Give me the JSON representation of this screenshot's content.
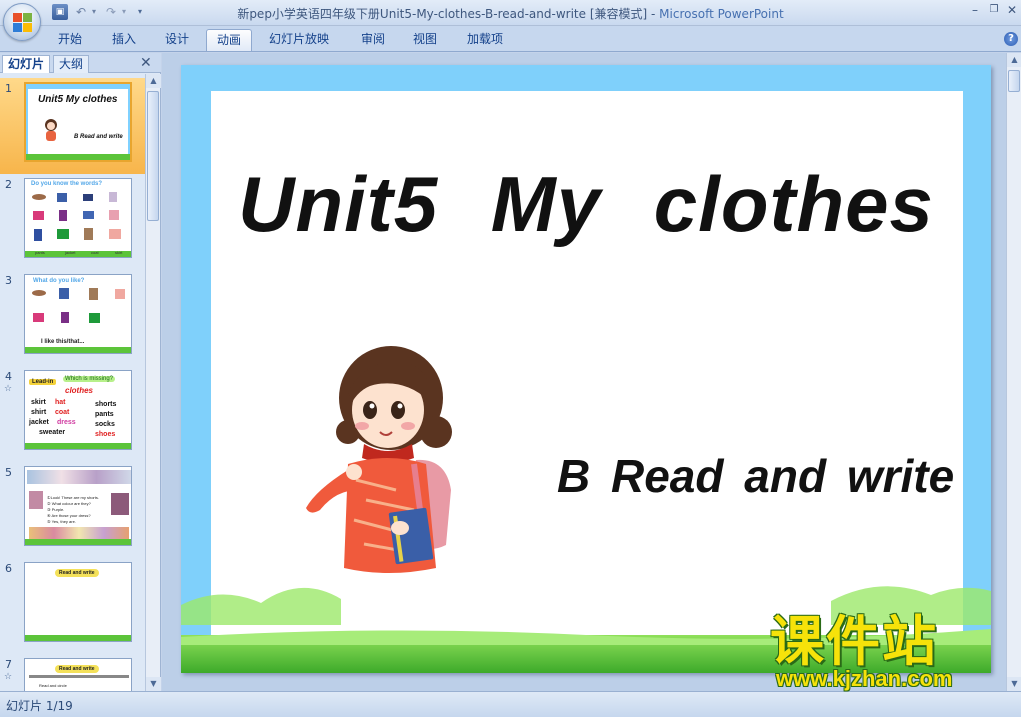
{
  "window": {
    "title": "新pep小学英语四年级下册Unit5-My-clothes-B-read-and-write [兼容模式]",
    "separator": " - ",
    "app_name": "Microsoft PowerPoint",
    "minimize": "–",
    "restore": "❐",
    "close": "✕"
  },
  "quick_access": {
    "save": "▣",
    "undo": "↶",
    "redo": "↷",
    "dropdown": "▾",
    "customize": "▾"
  },
  "ribbon_tabs": [
    {
      "label": "开始"
    },
    {
      "label": "插入"
    },
    {
      "label": "设计"
    },
    {
      "label": "动画",
      "active": true
    },
    {
      "label": "幻灯片放映"
    },
    {
      "label": "审阅"
    },
    {
      "label": "视图"
    },
    {
      "label": "加载项"
    }
  ],
  "help": "?",
  "panel": {
    "tab_slides": "幻灯片",
    "tab_outline": "大纲",
    "close": "✕",
    "scroll_up": "▲",
    "scroll_down": "▼"
  },
  "thumbnails": [
    {
      "num": "1",
      "selected": true,
      "title": "Unit5 My clothes",
      "sub": "B  Read and write"
    },
    {
      "num": "2",
      "title": "Do you know the words?",
      "words": [
        "hat",
        "shirt",
        "skirt",
        "shorts",
        "sweater",
        "dress",
        "socks",
        "coat",
        "pants",
        "jacket"
      ]
    },
    {
      "num": "3",
      "title": "What do you like?",
      "words": [
        "hat",
        "skirt",
        "sweater",
        "dress",
        "coat",
        "jacket"
      ],
      "line": "I like this/that..."
    },
    {
      "num": "4",
      "anim": "☆",
      "tag": "Lead-in",
      "bubble": "Which is missing?",
      "heading": "clothes",
      "col1": [
        "skirt",
        "shirt",
        "jacket",
        "sweater"
      ],
      "col1b": [
        "hat",
        "coat",
        "dress"
      ],
      "col2": [
        "shorts",
        "pants",
        "socks",
        "shoes"
      ]
    },
    {
      "num": "5",
      "lines": [
        "①Look! These are my shorts.",
        "② What colour are they?",
        "③ Purple.",
        "④ Are those your dress?",
        "⑤ Yes, they are."
      ]
    },
    {
      "num": "6",
      "banner": "Read and write"
    },
    {
      "num": "7",
      "anim": "☆",
      "banner": "Read and write",
      "line": "Read and circle"
    }
  ],
  "slide": {
    "title": "Unit5  My clothes",
    "subtitle": "B  Read and write"
  },
  "watermark": {
    "cn": "课件站",
    "url": "www.kjzhan.com"
  },
  "status": {
    "slide_indicator": "幻灯片 1/19"
  },
  "colors": {
    "sky": "#7fd0fb",
    "grass": "#5cc43a",
    "ribbon": "#c6d7ee",
    "selected_thumb": "#f7b54b",
    "watermark": "#f6e20a"
  }
}
